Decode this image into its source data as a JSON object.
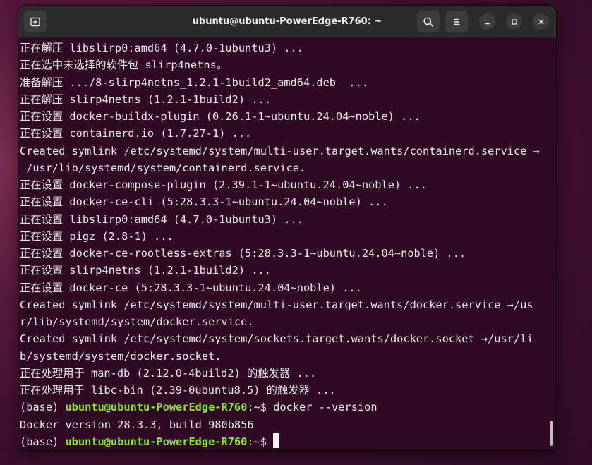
{
  "window": {
    "title": "ubuntu@ubuntu-PowerEdge-R760: ~"
  },
  "icons": {
    "new_tab": "new-tab-icon",
    "search": "search-icon",
    "menu": "hamburger-menu-icon",
    "minimize": "minimize-icon",
    "maximize": "maximize-icon",
    "close": "close-icon"
  },
  "colors": {
    "terminal_bg": "#300a24",
    "titlebar_bg": "#2b2b2b",
    "prompt_user": "#8ae234",
    "text": "#e9e9e9"
  },
  "terminal": {
    "lines": [
      "正在解压 libslirp0:amd64 (4.7.0-1ubuntu3) ...",
      "正在选中未选择的软件包 slirp4netns。",
      "准备解压 .../8-slirp4netns_1.2.1-1build2_amd64.deb  ...",
      "正在解压 slirp4netns (1.2.1-1build2) ...",
      "正在设置 docker-buildx-plugin (0.26.1-1~ubuntu.24.04~noble) ...",
      "正在设置 containerd.io (1.7.27-1) ...",
      "Created symlink /etc/systemd/system/multi-user.target.wants/containerd.service →",
      " /usr/lib/systemd/system/containerd.service.",
      "正在设置 docker-compose-plugin (2.39.1-1~ubuntu.24.04~noble) ...",
      "正在设置 docker-ce-cli (5:28.3.3-1~ubuntu.24.04~noble) ...",
      "正在设置 libslirp0:amd64 (4.7.0-1ubuntu3) ...",
      "正在设置 pigz (2.8-1) ...",
      "正在设置 docker-ce-rootless-extras (5:28.3.3-1~ubuntu.24.04~noble) ...",
      "正在设置 slirp4netns (1.2.1-1build2) ...",
      "正在设置 docker-ce (5:28.3.3-1~ubuntu.24.04~noble) ...",
      "Created symlink /etc/systemd/system/multi-user.target.wants/docker.service →/us",
      "r/lib/systemd/system/docker.service.",
      "Created symlink /etc/systemd/system/sockets.target.wants/docker.socket →/usr/li",
      "b/systemd/system/docker.socket.",
      "正在处理用于 man-db (2.12.0-4build2) 的触发器 ...",
      "正在处理用于 libc-bin (2.39-0ubuntu8.5) 的触发器 ..."
    ],
    "prompt1": {
      "env": "(base) ",
      "user_host": "ubuntu@ubuntu-PowerEdge-R760",
      "suffix": ":~$ ",
      "command": "docker --version"
    },
    "output": "Docker version 28.3.3, build 980b856",
    "prompt2": {
      "env": "(base) ",
      "user_host": "ubuntu@ubuntu-PowerEdge-R760",
      "suffix": ":~$ "
    }
  }
}
